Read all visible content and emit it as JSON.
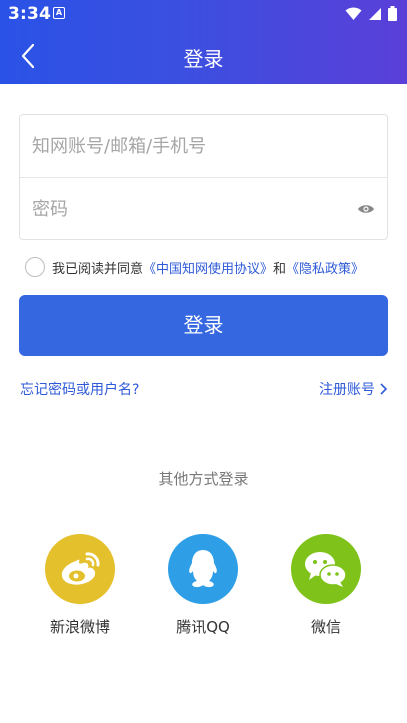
{
  "status_bar": {
    "time": "3:34",
    "notification_badge": "A",
    "icons": [
      "wifi-icon",
      "signal-icon",
      "battery-icon"
    ]
  },
  "nav": {
    "title": "登录",
    "back_icon": "chevron-left-icon"
  },
  "form": {
    "account_placeholder": "知网账号/邮箱/手机号",
    "password_placeholder": "密码",
    "eye_icon": "eye-icon"
  },
  "agreement": {
    "prefix": "我已阅读并同意",
    "terms_link": "《中国知网使用协议》",
    "conjunction": "和",
    "privacy_link": "《隐私政策》",
    "checked": false
  },
  "login_button": "登录",
  "links": {
    "forgot": "忘记密码或用户名?",
    "register": "注册账号"
  },
  "other_login": {
    "heading": "其他方式登录",
    "providers": [
      {
        "label": "新浪微博",
        "icon": "weibo-icon",
        "color": "#e5c02d"
      },
      {
        "label": "腾讯QQ",
        "icon": "qq-icon",
        "color": "#2e9ee6"
      },
      {
        "label": "微信",
        "icon": "wechat-icon",
        "color": "#7fc21a"
      }
    ]
  },
  "colors": {
    "header_start": "#2a52e6",
    "header_end": "#5a3fd8",
    "primary": "#3568e0",
    "link": "#2e5ad8"
  }
}
